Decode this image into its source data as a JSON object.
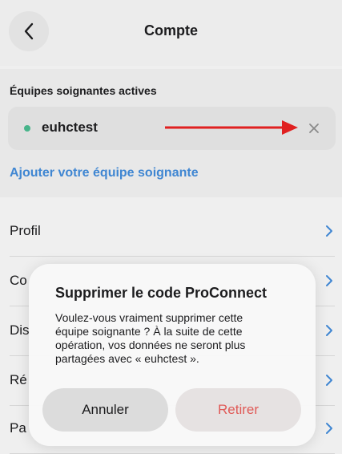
{
  "header": {
    "title": "Compte"
  },
  "teams": {
    "section_label": "Équipes soignantes actives",
    "items": [
      {
        "name": "euhctest",
        "status_color": "#47b48a"
      }
    ],
    "add_label": "Ajouter votre équipe soignante"
  },
  "menu": {
    "items": [
      {
        "label": "Profil"
      },
      {
        "label": "Co"
      },
      {
        "label": "Dis"
      },
      {
        "label": "Ré"
      },
      {
        "label": "Pa"
      }
    ]
  },
  "dialog": {
    "title": "Supprimer le code ProConnect",
    "message": "Voulez-vous vraiment supprimer cette équipe soignante ? À la suite de cette opération, vos données ne seront plus partagées avec « euhctest ».",
    "cancel_label": "Annuler",
    "confirm_label": "Retirer"
  },
  "colors": {
    "accent": "#3f86d2",
    "destructive": "#e05a57",
    "arrow": "#e02020"
  }
}
